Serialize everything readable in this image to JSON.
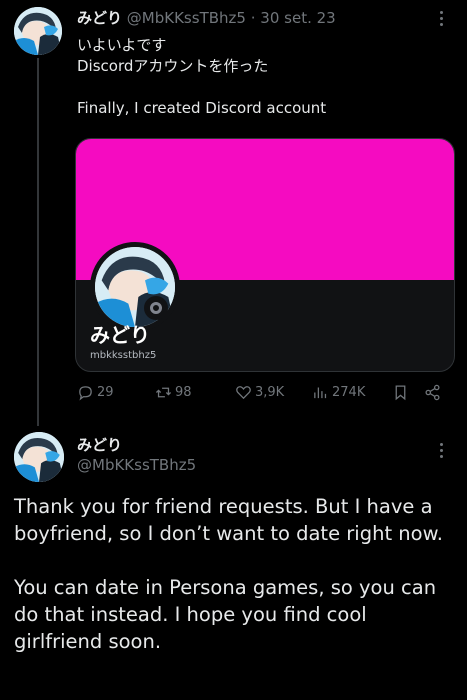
{
  "tweet1": {
    "display_name": "みどり",
    "handle": "@MbKKssTBhz5",
    "separator": "·",
    "date": "30 set. 23",
    "lines": [
      "いよいよです",
      "Discordアカウントを作った",
      "",
      "Finally, I created Discord account"
    ],
    "card": {
      "banner_color": "#f50bc1",
      "name": "みどり",
      "username": "mbkksstbhz5"
    },
    "actions": {
      "replies": "29",
      "retweets": "98",
      "likes": "3,9K",
      "views": "274K"
    }
  },
  "tweet2": {
    "display_name": "みどり",
    "handle": "@MbKKssTBhz5",
    "paragraphs": [
      "Thank you for friend requests. But I have a boyfriend, so I don’t want to date right now.",
      "You can date in Persona games, so you can do that instead. I hope you find cool girlfriend soon."
    ]
  }
}
